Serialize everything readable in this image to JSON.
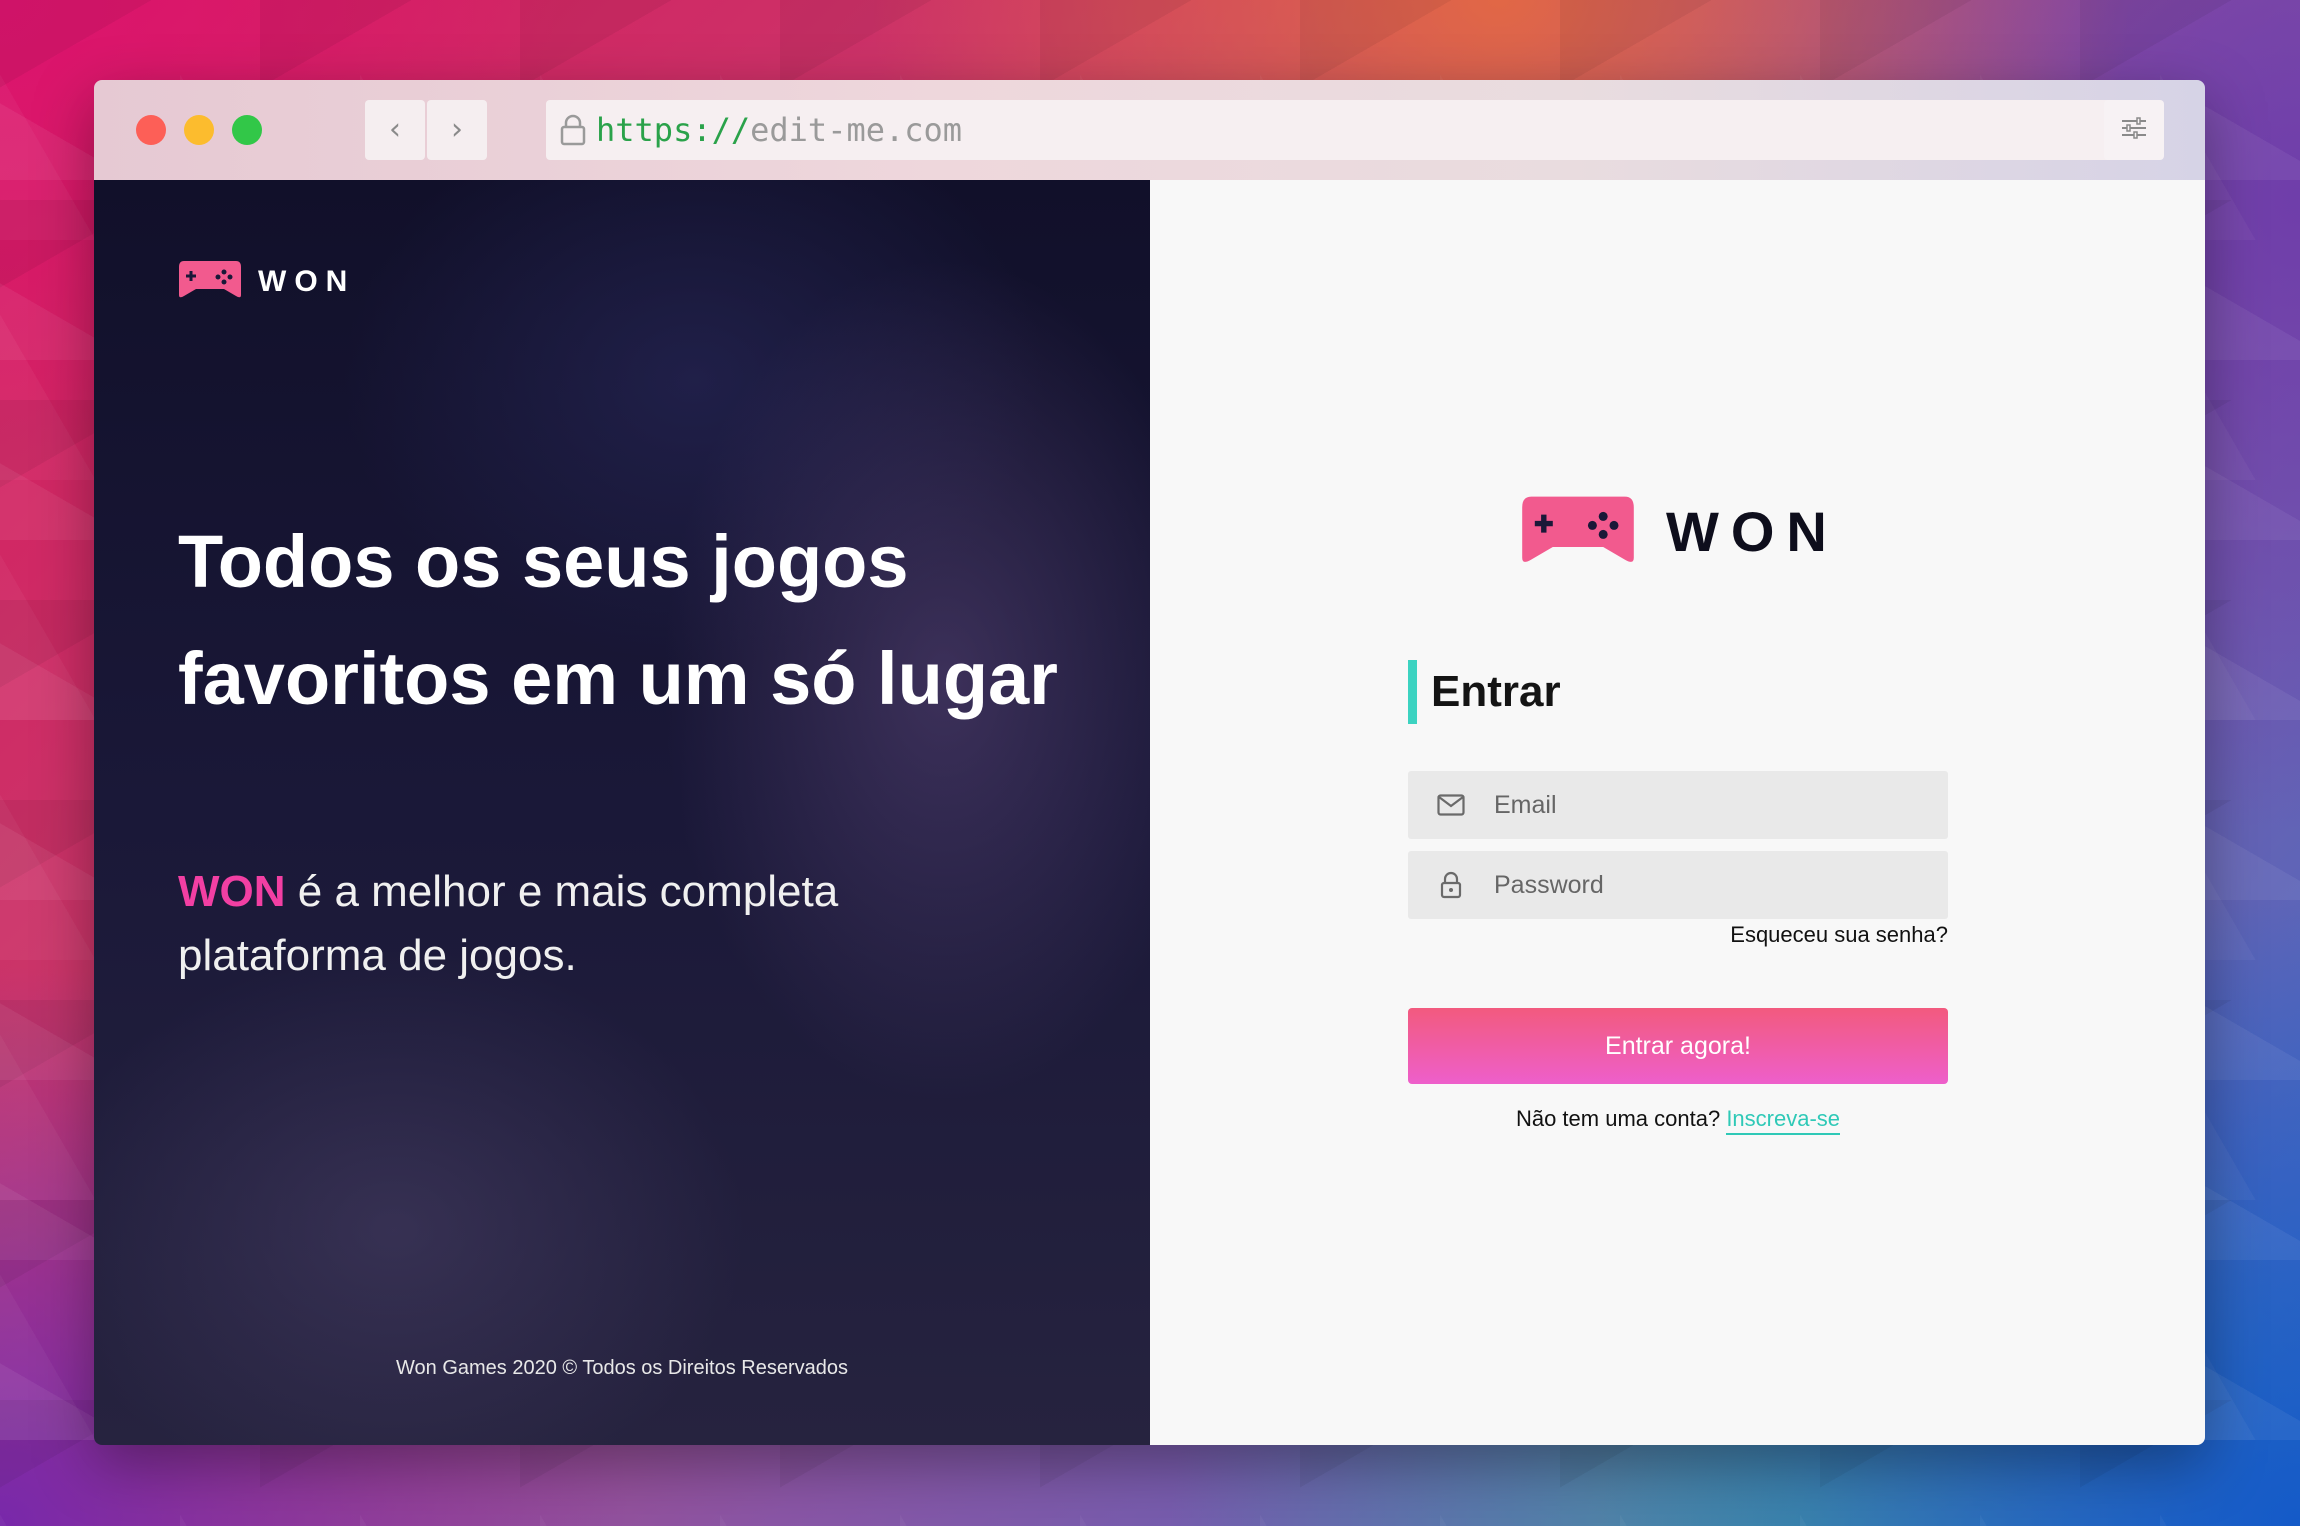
{
  "browser": {
    "url_protocol": "https://",
    "url_host": "edit-me.com",
    "icons": {
      "back": "chevron-left-icon",
      "forward": "chevron-right-icon",
      "lock": "lock-icon",
      "menu": "sliders-icon"
    }
  },
  "banner": {
    "logo_text": "WON",
    "headline": "Todos os seus jogos favoritos em um só lugar",
    "subtitle_brand": "WON",
    "subtitle_rest": " é a melhor e mais completa plataforma de jogos.",
    "footer": "Won Games 2020 © Todos os Direitos Reservados"
  },
  "form": {
    "logo_text": "WON",
    "title": "Entrar",
    "email_placeholder": "Email",
    "password_placeholder": "Password",
    "forgot_link": "Esqueceu sua senha?",
    "submit_label": "Entrar agora!",
    "signup_prompt": "Não tem uma conta?",
    "signup_link": "Inscreva-se"
  },
  "colors": {
    "brand_pink": "#f23fa3",
    "accent_teal": "#3cd3c1",
    "button_gradient_start": "#f25a7e",
    "button_gradient_end": "#ee5fcb"
  }
}
